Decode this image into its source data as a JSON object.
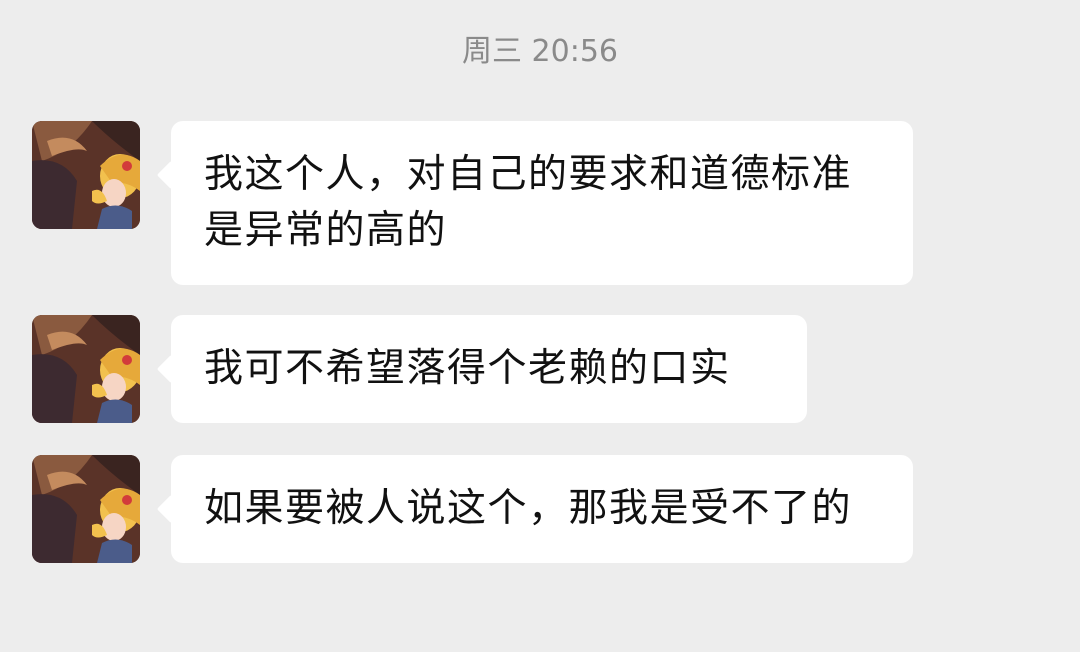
{
  "timestamp": "周三 20:56",
  "messages": [
    {
      "text": "我这个人，对自己的要求和道德标准是异常的高的",
      "avatar": "anime-girl-avatar"
    },
    {
      "text": "我可不希望落得个老赖的口实",
      "avatar": "anime-girl-avatar"
    },
    {
      "text": "如果要被人说这个，那我是受不了的",
      "avatar": "anime-girl-avatar"
    }
  ],
  "colors": {
    "background": "#ededed",
    "bubble": "#ffffff",
    "timestamp_text": "#8a8a8a",
    "message_text": "#111111"
  }
}
